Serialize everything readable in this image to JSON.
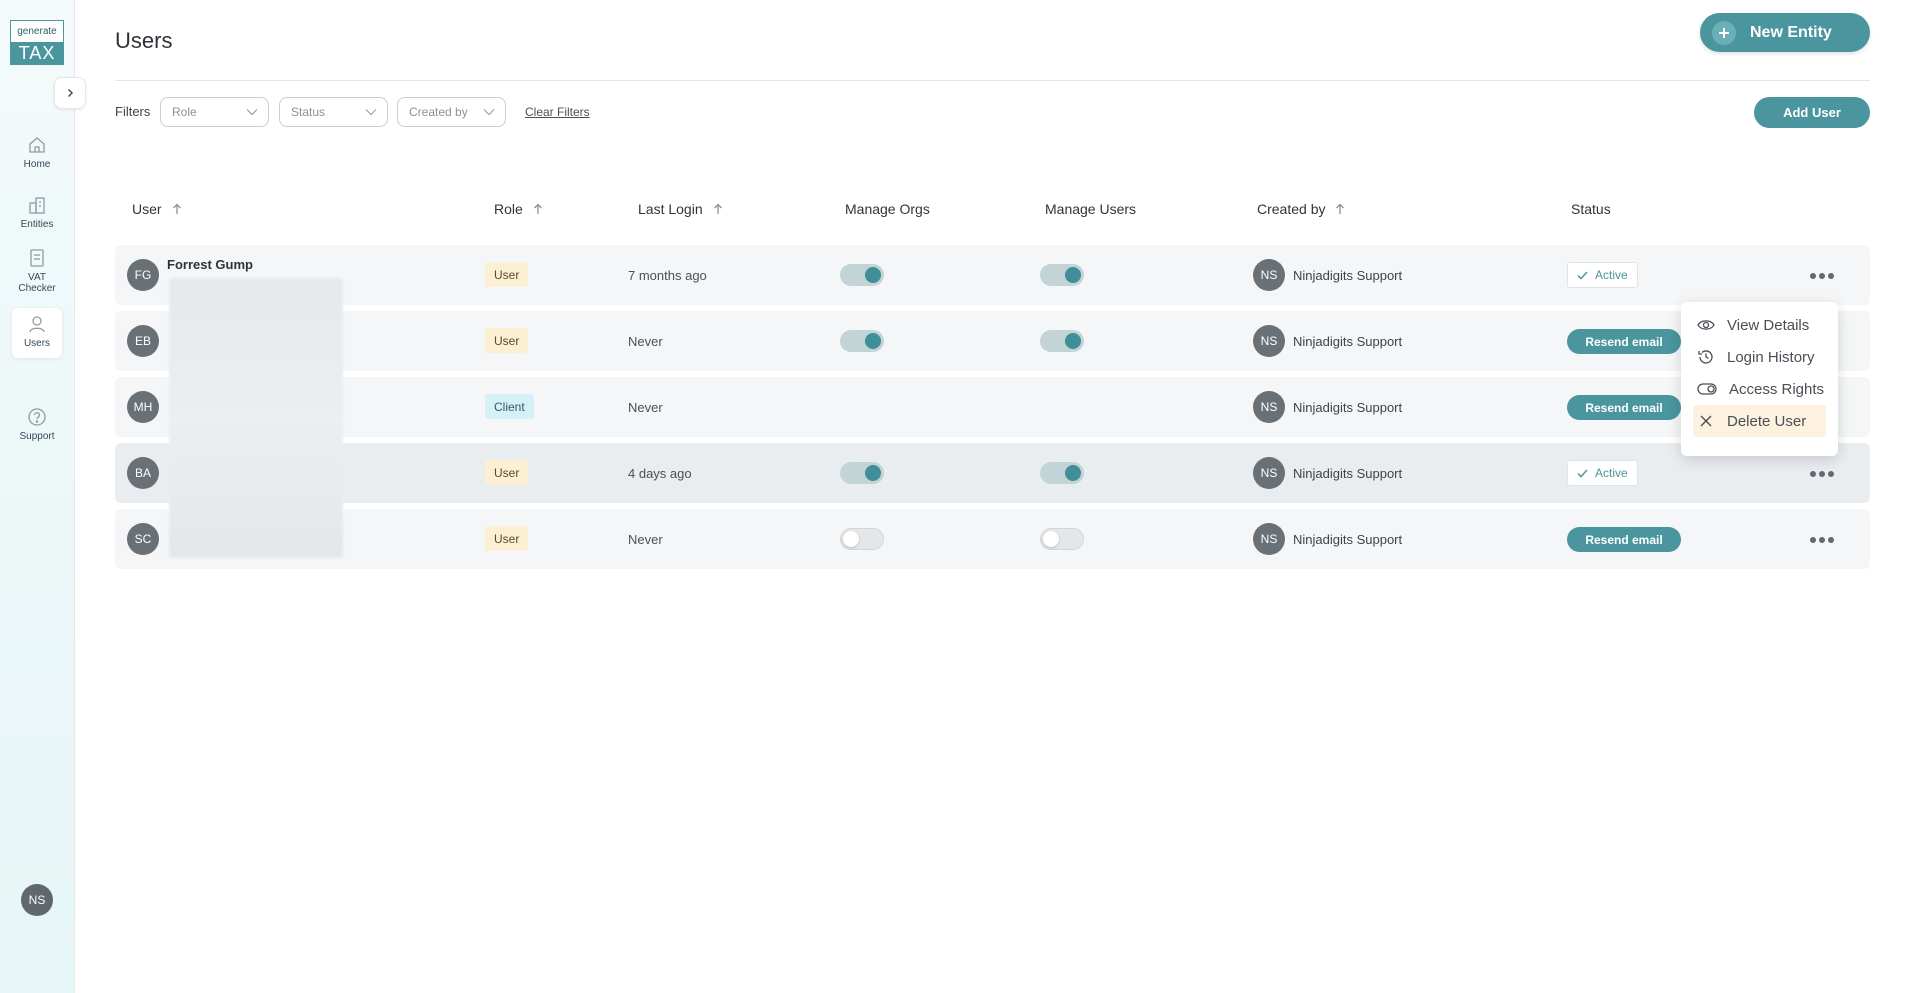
{
  "logo": {
    "top": "generate",
    "bottom": "TAX"
  },
  "nav": [
    {
      "label": "Home",
      "icon": "home-icon"
    },
    {
      "label": "Entities",
      "icon": "building-icon"
    },
    {
      "label": "VAT Checker",
      "icon": "document-icon"
    },
    {
      "label": "Users",
      "icon": "user-icon",
      "active": true
    },
    {
      "label": "Support",
      "icon": "help-icon"
    }
  ],
  "sidebar_avatar": "NS",
  "header": {
    "title": "Users",
    "new_entity_label": "New Entity"
  },
  "filters": {
    "label": "Filters",
    "role_placeholder": "Role",
    "status_placeholder": "Status",
    "created_by_placeholder": "Created by",
    "clear_label": "Clear Filters",
    "add_user_label": "Add User"
  },
  "columns": {
    "user": "User",
    "role": "Role",
    "last_login": "Last Login",
    "manage_orgs": "Manage Orgs",
    "manage_users": "Manage Users",
    "created_by": "Created by",
    "status": "Status"
  },
  "rows": [
    {
      "initials": "FG",
      "name": "Forrest Gump",
      "role": "User",
      "last_login": "7 months ago",
      "manage_orgs": true,
      "manage_users": true,
      "creator_initials": "NS",
      "creator": "Ninjadigits Support",
      "status": "Active"
    },
    {
      "initials": "EB",
      "name": "",
      "role": "User",
      "last_login": "Never",
      "manage_orgs": true,
      "manage_users": true,
      "creator_initials": "NS",
      "creator": "Ninjadigits Support",
      "status": "Resend email"
    },
    {
      "initials": "MH",
      "name": "",
      "role": "Client",
      "last_login": "Never",
      "manage_orgs": null,
      "manage_users": null,
      "creator_initials": "NS",
      "creator": "Ninjadigits Support",
      "status": "Resend email"
    },
    {
      "initials": "BA",
      "name": "",
      "role": "User",
      "last_login": "4 days ago",
      "manage_orgs": true,
      "manage_users": true,
      "creator_initials": "NS",
      "creator": "Ninjadigits Support",
      "status": "Active"
    },
    {
      "initials": "SC",
      "name": "",
      "role": "User",
      "last_login": "Never",
      "manage_orgs": false,
      "manage_users": false,
      "creator_initials": "NS",
      "creator": "Ninjadigits Support",
      "status": "Resend email"
    }
  ],
  "menu": {
    "view_details": "View Details",
    "login_history": "Login History",
    "access_rights": "Access Rights",
    "delete_user": "Delete User"
  },
  "colors": {
    "accent": "#4a959e",
    "menu_highlight": "#fcf2df"
  }
}
